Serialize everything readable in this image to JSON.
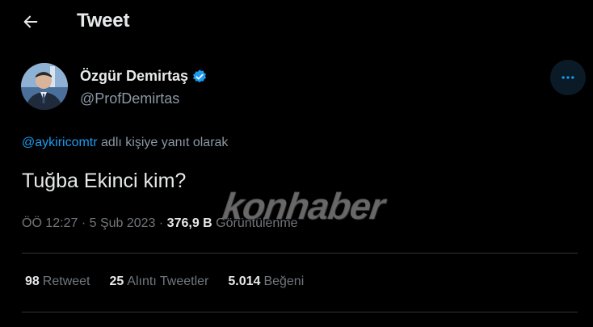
{
  "header": {
    "title": "Tweet"
  },
  "author": {
    "name": "Özgür Demirtaş",
    "handle": "@ProfDemirtas"
  },
  "reply": {
    "mention": "@aykiricomtr",
    "suffix": " adlı kişiye yanıt olarak"
  },
  "tweet": {
    "text": "Tuğba Ekinci kim?"
  },
  "meta": {
    "time": "ÖÖ 12:27",
    "separator": " · ",
    "date": "5 Şub 2023",
    "separator2": " · ",
    "views": "376,9 B",
    "views_label": " Görüntülenme"
  },
  "stats": [
    {
      "count": "98",
      "label": "Retweet"
    },
    {
      "count": "25",
      "label": "Alıntı Tweetler"
    },
    {
      "count": "5.014",
      "label": "Beğeni"
    }
  ],
  "watermark": "konhaber",
  "colors": {
    "accent": "#1d9bf0",
    "background": "#000000",
    "muted": "#71767b"
  },
  "icons": {
    "back": "arrow-left-icon",
    "verified": "verified-badge-icon",
    "more": "more-horizontal-icon"
  }
}
